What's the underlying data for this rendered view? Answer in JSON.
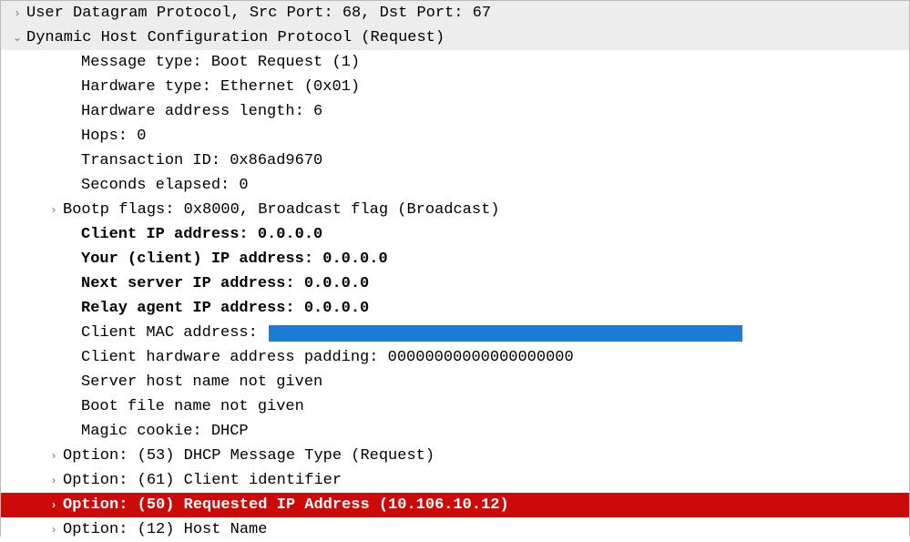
{
  "rows": [
    {
      "indent": 0,
      "expander": "collapsed",
      "header": true,
      "bold": false,
      "highlighted": false,
      "text": "User Datagram Protocol, Src Port: 68, Dst Port: 67"
    },
    {
      "indent": 0,
      "expander": "expanded",
      "header": true,
      "bold": false,
      "highlighted": false,
      "text": "Dynamic Host Configuration Protocol (Request)"
    },
    {
      "indent": 2,
      "expander": "none",
      "header": false,
      "bold": false,
      "highlighted": false,
      "text": "Message type: Boot Request (1)"
    },
    {
      "indent": 2,
      "expander": "none",
      "header": false,
      "bold": false,
      "highlighted": false,
      "text": "Hardware type: Ethernet (0x01)"
    },
    {
      "indent": 2,
      "expander": "none",
      "header": false,
      "bold": false,
      "highlighted": false,
      "text": "Hardware address length: 6"
    },
    {
      "indent": 2,
      "expander": "none",
      "header": false,
      "bold": false,
      "highlighted": false,
      "text": "Hops: 0"
    },
    {
      "indent": 2,
      "expander": "none",
      "header": false,
      "bold": false,
      "highlighted": false,
      "text": "Transaction ID: 0x86ad9670"
    },
    {
      "indent": 2,
      "expander": "none",
      "header": false,
      "bold": false,
      "highlighted": false,
      "text": "Seconds elapsed: 0"
    },
    {
      "indent": 1,
      "expander": "collapsed",
      "header": false,
      "bold": false,
      "highlighted": false,
      "text": "Bootp flags: 0x8000, Broadcast flag (Broadcast)"
    },
    {
      "indent": 2,
      "expander": "none",
      "header": false,
      "bold": true,
      "highlighted": false,
      "text": "Client IP address: 0.0.0.0"
    },
    {
      "indent": 2,
      "expander": "none",
      "header": false,
      "bold": true,
      "highlighted": false,
      "text": "Your (client) IP address: 0.0.0.0"
    },
    {
      "indent": 2,
      "expander": "none",
      "header": false,
      "bold": true,
      "highlighted": false,
      "text": "Next server IP address: 0.0.0.0"
    },
    {
      "indent": 2,
      "expander": "none",
      "header": false,
      "bold": true,
      "highlighted": false,
      "text": "Relay agent IP address: 0.0.0.0"
    },
    {
      "indent": 2,
      "expander": "none",
      "header": false,
      "bold": false,
      "highlighted": false,
      "text": "Client MAC address: ",
      "redacted": true
    },
    {
      "indent": 2,
      "expander": "none",
      "header": false,
      "bold": false,
      "highlighted": false,
      "text": "Client hardware address padding: 00000000000000000000"
    },
    {
      "indent": 2,
      "expander": "none",
      "header": false,
      "bold": false,
      "highlighted": false,
      "text": "Server host name not given"
    },
    {
      "indent": 2,
      "expander": "none",
      "header": false,
      "bold": false,
      "highlighted": false,
      "text": "Boot file name not given"
    },
    {
      "indent": 2,
      "expander": "none",
      "header": false,
      "bold": false,
      "highlighted": false,
      "text": "Magic cookie: DHCP"
    },
    {
      "indent": 1,
      "expander": "collapsed",
      "header": false,
      "bold": false,
      "highlighted": false,
      "text": "Option: (53) DHCP Message Type (Request)"
    },
    {
      "indent": 1,
      "expander": "collapsed",
      "header": false,
      "bold": false,
      "highlighted": false,
      "text": "Option: (61) Client identifier"
    },
    {
      "indent": 1,
      "expander": "collapsed",
      "header": false,
      "bold": true,
      "highlighted": true,
      "text": "Option: (50) Requested IP Address (10.106.10.12)"
    },
    {
      "indent": 1,
      "expander": "collapsed",
      "header": false,
      "bold": false,
      "highlighted": false,
      "text": "Option: (12) Host Name"
    }
  ],
  "expander_glyphs": {
    "collapsed": "›",
    "expanded": "⌄",
    "none": " "
  }
}
